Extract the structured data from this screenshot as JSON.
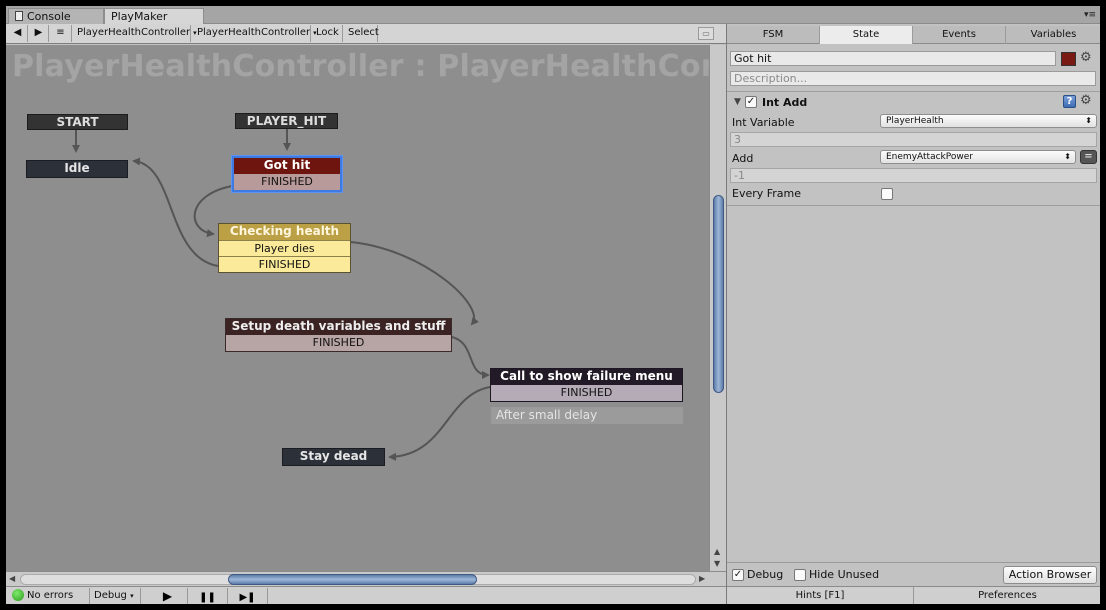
{
  "tabs": [
    {
      "label": "Console"
    },
    {
      "label": "PlayMaker"
    }
  ],
  "toolbar": {
    "back_icon": "◀",
    "forward_icon": "▶",
    "menu_icon": "≡",
    "selector1": "PlayerHealthController",
    "selector2": "PlayerHealthController",
    "lock": "Lock",
    "select": "Select"
  },
  "graph": {
    "title": "PlayerHealthController : PlayerHealthController",
    "global_events": {
      "start": "START",
      "player_hit": "PLAYER_HIT"
    },
    "states": {
      "idle": "Idle",
      "got_hit": {
        "title": "Got hit",
        "transition": "FINISHED"
      },
      "checking": {
        "title": "Checking health",
        "t1": "Player dies",
        "t2": "FINISHED"
      },
      "setup": {
        "title": "Setup death variables and stuff",
        "transition": "FINISHED"
      },
      "failure": {
        "title": "Call to show failure menu",
        "transition": "FINISHED",
        "comment": "After small delay"
      },
      "stay_dead": "Stay dead"
    }
  },
  "status": {
    "errors": "No errors",
    "debug": "Debug",
    "play_icon": "▶",
    "pause_icon": "❚❚",
    "step_icon": "▶❚"
  },
  "inspector": {
    "tabs": [
      "FSM",
      "State",
      "Events",
      "Variables"
    ],
    "state_name": "Got hit",
    "description_placeholder": "Description...",
    "state_color": "#7a1a14",
    "action": {
      "title": "Int Add",
      "enabled": true,
      "int_variable_label": "Int Variable",
      "int_variable_value": "PlayerHealth",
      "int_variable_readonly": "3",
      "add_label": "Add",
      "add_value": "EnemyAttackPower",
      "add_readonly": "-1",
      "every_frame_label": "Every Frame",
      "every_frame": false
    },
    "bottom": {
      "debug_label": "Debug",
      "debug_checked": true,
      "hide_unused_label": "Hide Unused",
      "hide_unused_checked": false,
      "action_browser": "Action Browser"
    },
    "footer": {
      "hints": "Hints [F1]",
      "preferences": "Preferences"
    }
  }
}
